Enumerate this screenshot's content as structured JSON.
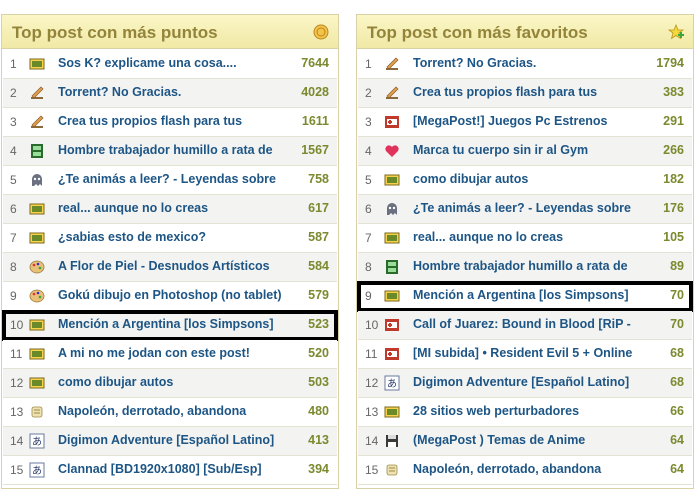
{
  "left_panel": {
    "title": "Top post con más puntos",
    "header_icon": "medal-icon",
    "rows": [
      {
        "num": "1",
        "icon": "image-icon",
        "title": "Sos K? explicame una cosa....",
        "value": "7644"
      },
      {
        "num": "2",
        "icon": "pencil-icon",
        "title": "Torrent? No Gracias.",
        "value": "4028"
      },
      {
        "num": "3",
        "icon": "pencil-icon",
        "title": "Crea tus propios flash para tus",
        "value": "1611"
      },
      {
        "num": "4",
        "icon": "film-icon",
        "title": "Hombre trabajador humillo a rata de",
        "value": "1567"
      },
      {
        "num": "5",
        "icon": "ghost-icon",
        "title": "¿Te animás a leer? - Leyendas sobre",
        "value": "758"
      },
      {
        "num": "6",
        "icon": "image-icon",
        "title": "real... aunque no lo creas",
        "value": "617"
      },
      {
        "num": "7",
        "icon": "image-icon",
        "title": "¿sabias esto de mexico?",
        "value": "587"
      },
      {
        "num": "8",
        "icon": "palette-icon",
        "title": "A Flor de Piel - Desnudos Artísticos",
        "value": "584"
      },
      {
        "num": "9",
        "icon": "palette-icon",
        "title": "Gokú dibujo en Photoshop (no tablet)",
        "value": "579"
      },
      {
        "num": "10",
        "icon": "image-icon",
        "title": "Mención a Argentina [los Simpsons]",
        "value": "523",
        "highlight": true
      },
      {
        "num": "11",
        "icon": "image-icon",
        "title": "A mi no me jodan con este post!",
        "value": "520"
      },
      {
        "num": "12",
        "icon": "image-icon",
        "title": "como dibujar autos",
        "value": "503"
      },
      {
        "num": "13",
        "icon": "scroll-icon",
        "title": "Napoleón, derrotado, abandona",
        "value": "480"
      },
      {
        "num": "14",
        "icon": "anime-icon",
        "title": "Digimon Adventure [Español Latino]",
        "value": "413"
      },
      {
        "num": "15",
        "icon": "anime-icon",
        "title": "Clannad [BD1920x1080] [Sub/Esp]",
        "value": "394"
      }
    ]
  },
  "right_panel": {
    "title": "Top post con más favoritos",
    "header_icon": "star-add-icon",
    "rows": [
      {
        "num": "1",
        "icon": "pencil-icon",
        "title": "Torrent? No Gracias.",
        "value": "1794"
      },
      {
        "num": "2",
        "icon": "pencil-icon",
        "title": "Crea tus propios flash para tus",
        "value": "383"
      },
      {
        "num": "3",
        "icon": "game-icon",
        "title": "[MegaPost!] Juegos Pc Estrenos",
        "value": "291"
      },
      {
        "num": "4",
        "icon": "heart-icon",
        "title": "Marca tu cuerpo sin ir al Gym",
        "value": "266"
      },
      {
        "num": "5",
        "icon": "image-icon",
        "title": "como dibujar autos",
        "value": "182"
      },
      {
        "num": "6",
        "icon": "ghost-icon",
        "title": "¿Te animás a leer? - Leyendas sobre",
        "value": "176"
      },
      {
        "num": "7",
        "icon": "image-icon",
        "title": "real... aunque no lo creas",
        "value": "105"
      },
      {
        "num": "8",
        "icon": "film-icon",
        "title": "Hombre trabajador humillo a rata de",
        "value": "89"
      },
      {
        "num": "9",
        "icon": "image-icon",
        "title": "Mención a Argentina [los Simpsons]",
        "value": "70",
        "highlight": true
      },
      {
        "num": "10",
        "icon": "game-icon",
        "title": "Call of Juarez: Bound in Blood [RiP -",
        "value": "70"
      },
      {
        "num": "11",
        "icon": "game-icon",
        "title": "[MI subida] • Resident Evil 5 + Online",
        "value": "68"
      },
      {
        "num": "12",
        "icon": "anime-icon",
        "title": "Digimon Adventure [Español Latino]",
        "value": "68"
      },
      {
        "num": "13",
        "icon": "image-icon",
        "title": "28 sitios web perturbadores",
        "value": "66"
      },
      {
        "num": "14",
        "icon": "disk-icon",
        "title": "(MegaPost ) Temas de Anime",
        "value": "64"
      },
      {
        "num": "15",
        "icon": "scroll-icon",
        "title": "Napoleón, derrotado, abandona",
        "value": "64"
      }
    ]
  }
}
